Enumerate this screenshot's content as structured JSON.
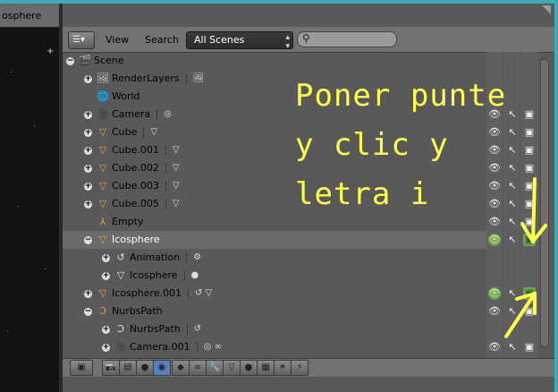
{
  "viewport": {
    "title": "osphere"
  },
  "header": {
    "editor_icon": "outliner-editor-icon",
    "menu": [
      "View",
      "Search"
    ],
    "display_mode": "All Scenes",
    "search_value": ""
  },
  "colors": {
    "annotation": "#ffff4d",
    "selected_row": "#6b6b6b",
    "object_text_selected": "#ffffff"
  },
  "tree": [
    {
      "label": "Scene",
      "icon": "scene-icon",
      "toggle": "collapse",
      "sub": ""
    },
    {
      "label": "RenderLayers",
      "icon": "render-layers-icon",
      "toggle": "expand",
      "sub": "render-layer-icon"
    },
    {
      "label": "World",
      "icon": "world-icon",
      "toggle": "",
      "sub": ""
    },
    {
      "label": "Camera",
      "icon": "camera-icon",
      "toggle": "expand",
      "sub": "camera-data-icon"
    },
    {
      "label": "Cube",
      "icon": "mesh-object-icon",
      "toggle": "expand",
      "sub": "mesh-data-icon"
    },
    {
      "label": "Cube.001",
      "icon": "mesh-object-icon",
      "toggle": "expand",
      "sub": "mesh-data-icon"
    },
    {
      "label": "Cube.002",
      "icon": "mesh-object-icon",
      "toggle": "expand",
      "sub": "mesh-data-icon"
    },
    {
      "label": "Cube.003",
      "icon": "mesh-object-icon",
      "toggle": "expand",
      "sub": "mesh-data-icon"
    },
    {
      "label": "Cube.005",
      "icon": "mesh-object-icon",
      "toggle": "expand",
      "sub": "mesh-data-icon"
    },
    {
      "label": "Empty",
      "icon": "empty-icon",
      "toggle": "",
      "sub": ""
    },
    {
      "label": "Icosphere",
      "icon": "mesh-object-icon",
      "toggle": "collapse",
      "sub": ""
    },
    {
      "label": "Animation",
      "icon": "animation-icon",
      "toggle": "expand",
      "sub": "action-icon"
    },
    {
      "label": "Icosphere",
      "icon": "mesh-data-icon",
      "toggle": "expand",
      "sub": "material-icon"
    },
    {
      "label": "Icosphere.001",
      "icon": "mesh-object-icon",
      "toggle": "expand",
      "sub": "animation-mesh-icon"
    },
    {
      "label": "NurbsPath",
      "icon": "curve-object-icon",
      "toggle": "collapse",
      "sub": ""
    },
    {
      "label": "NurbsPath",
      "icon": "curve-data-icon",
      "toggle": "expand",
      "sub": "curve-icon"
    },
    {
      "label": "Camera.001",
      "icon": "camera-icon",
      "toggle": "expand",
      "sub": "camera-data-link-icon"
    }
  ],
  "annotation": {
    "lines": [
      "Poner punte",
      "y clic y",
      "letra i"
    ]
  }
}
